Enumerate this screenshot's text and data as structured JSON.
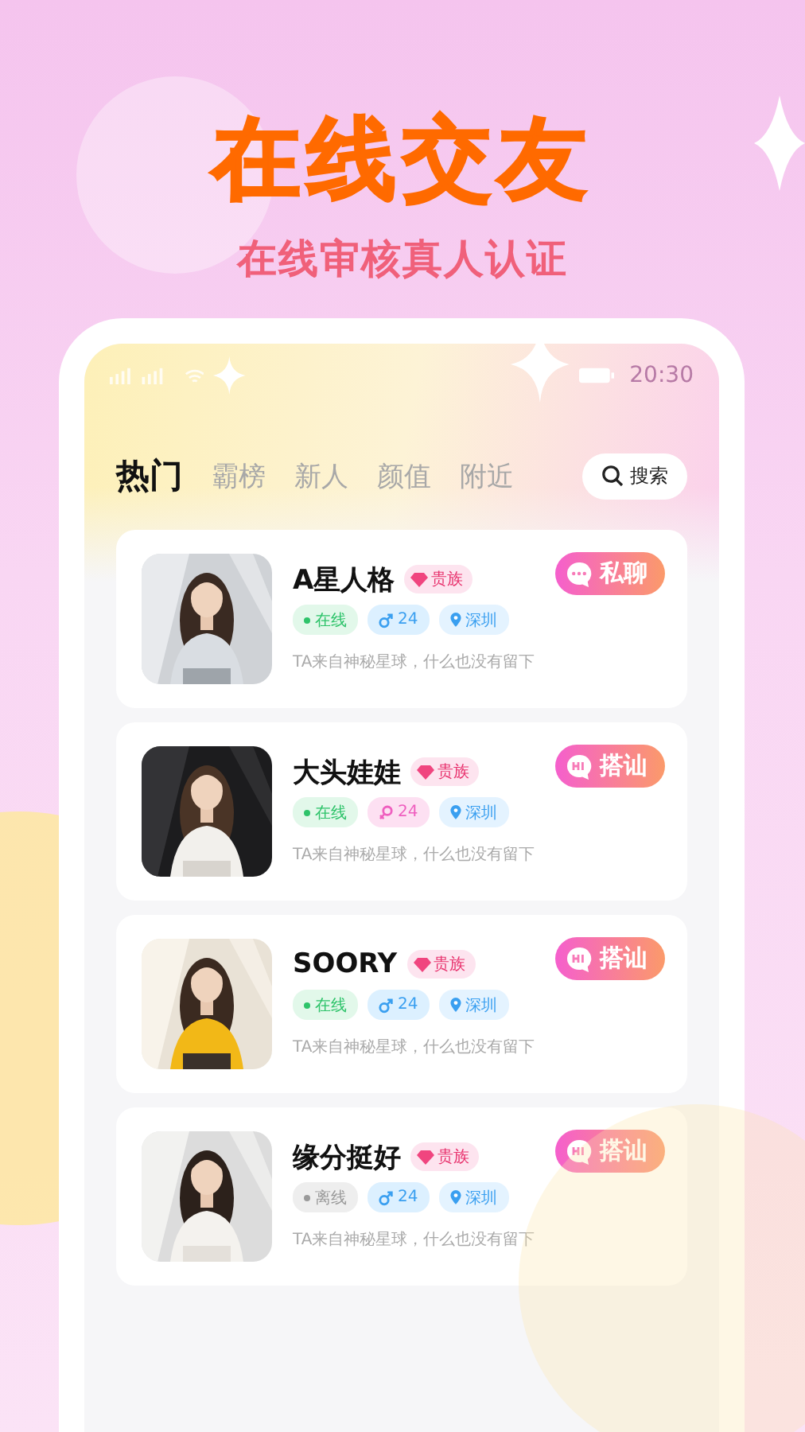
{
  "headline": "在线交友",
  "subtitle": "在线审核真人认证",
  "status_bar": {
    "time": "20:30"
  },
  "tabs": [
    {
      "label": "热门",
      "selected": true
    },
    {
      "label": "霸榜",
      "selected": false
    },
    {
      "label": "新人",
      "selected": false
    },
    {
      "label": "颜值",
      "selected": false
    },
    {
      "label": "附近",
      "selected": false
    }
  ],
  "search": {
    "label": "搜索"
  },
  "users": [
    {
      "name": "A星人格",
      "badge": "贵族",
      "online": true,
      "status": "在线",
      "age_tag": {
        "kind": "male",
        "text": "24"
      },
      "city": "深圳",
      "bio": "TA来自神秘星球，什么也没有留下",
      "action": {
        "kind": "chat",
        "label": "私聊"
      }
    },
    {
      "name": "大头娃娃",
      "badge": "贵族",
      "online": true,
      "status": "在线",
      "age_tag": {
        "kind": "female",
        "text": "24"
      },
      "city": "深圳",
      "bio": "TA来自神秘星球，什么也没有留下",
      "action": {
        "kind": "hi",
        "label": "搭讪"
      }
    },
    {
      "name": "SOORY",
      "badge": "贵族",
      "online": true,
      "status": "在线",
      "age_tag": {
        "kind": "male",
        "text": "24"
      },
      "city": "深圳",
      "bio": "TA来自神秘星球，什么也没有留下",
      "action": {
        "kind": "hi",
        "label": "搭讪"
      }
    },
    {
      "name": "缘分挺好",
      "badge": "贵族",
      "online": false,
      "status": "离线",
      "age_tag": {
        "kind": "male",
        "text": "24"
      },
      "city": "深圳",
      "bio": "TA来自神秘星球，什么也没有留下",
      "action": {
        "kind": "hi",
        "label": "搭讪"
      }
    }
  ]
}
